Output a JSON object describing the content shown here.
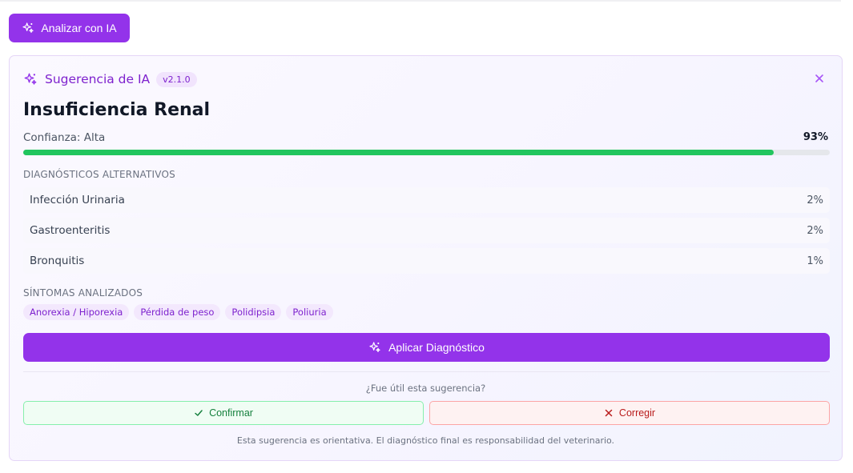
{
  "analyze_button": {
    "label": "Analizar con IA"
  },
  "suggestion": {
    "title": "Sugerencia de IA",
    "version": "v2.1.0",
    "diagnosis": "Insuficiencia Renal",
    "confidence_label": "Confianza: Alta",
    "confidence_value": "93%",
    "confidence_fraction": 0.93,
    "alternatives_heading": "DIAGNÓSTICOS ALTERNATIVOS",
    "alternatives": [
      {
        "name": "Infección Urinaria",
        "pct": "2%"
      },
      {
        "name": "Gastroenteritis",
        "pct": "2%"
      },
      {
        "name": "Bronquitis",
        "pct": "1%"
      }
    ],
    "symptoms_heading": "SÍNTOMAS ANALIZADOS",
    "symptoms": [
      "Anorexia / Hiporexia",
      "Pérdida de peso",
      "Polidipsia",
      "Poliuria"
    ],
    "apply_label": "Aplicar Diagnóstico",
    "feedback_question": "¿Fue útil esta sugerencia?",
    "confirm_label": "Confirmar",
    "correct_label": "Corregir",
    "disclaimer": "Esta sugerencia es orientativa. El diagnóstico final es responsabilidad del veterinario."
  },
  "colors": {
    "accent": "#9333ea",
    "accent_text": "#7e22ce",
    "confidence_bar": "#22c55e",
    "confirm": "#15803d",
    "correct": "#b91c1c"
  },
  "icons": {
    "analyze": "sparkles-icon",
    "header": "sparkles-icon",
    "close": "close-icon",
    "apply": "sparkles-icon",
    "confirm": "check-icon",
    "correct": "x-icon"
  }
}
